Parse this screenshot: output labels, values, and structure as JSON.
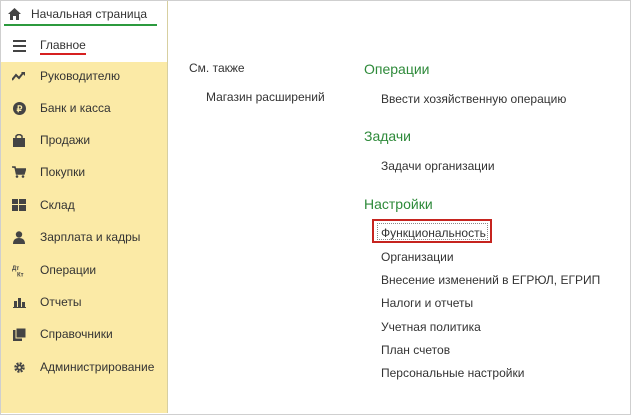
{
  "sidebar": {
    "home_tab": {
      "label": "Начальная страница",
      "icon": "home-icon"
    },
    "items": [
      {
        "label": "Главное",
        "icon": "menu-icon"
      },
      {
        "label": "Руководителю",
        "icon": "trend-icon"
      },
      {
        "label": "Банк и касса",
        "icon": "coin-icon"
      },
      {
        "label": "Продажи",
        "icon": "bag-icon"
      },
      {
        "label": "Покупки",
        "icon": "cart-icon"
      },
      {
        "label": "Склад",
        "icon": "warehouse-icon"
      },
      {
        "label": "Зарплата и кадры",
        "icon": "person-icon"
      },
      {
        "label": "Операции",
        "icon": "dt-kt-icon"
      },
      {
        "label": "Отчеты",
        "icon": "bar-chart-icon"
      },
      {
        "label": "Справочники",
        "icon": "books-icon"
      },
      {
        "label": "Администрирование",
        "icon": "gear-icon"
      }
    ]
  },
  "see_also": {
    "title": "См. также",
    "links": [
      "Магазин расширений"
    ]
  },
  "sections": {
    "operations": {
      "title": "Операции",
      "links": [
        "Ввести хозяйственную операцию"
      ]
    },
    "tasks": {
      "title": "Задачи",
      "links": [
        "Задачи организации"
      ]
    },
    "settings": {
      "title": "Настройки",
      "links": [
        "Функциональность",
        "Организации",
        "Внесение изменений в ЕГРЮЛ, ЕГРИП",
        "Налоги и отчеты",
        "Учетная политика",
        "План счетов",
        "Персональные настройки"
      ]
    }
  },
  "colors": {
    "sidebar_bg": "#fbeaa6",
    "section_title": "#2e8a3a",
    "highlight": "#c6241f",
    "active_underline": "#d62020"
  }
}
